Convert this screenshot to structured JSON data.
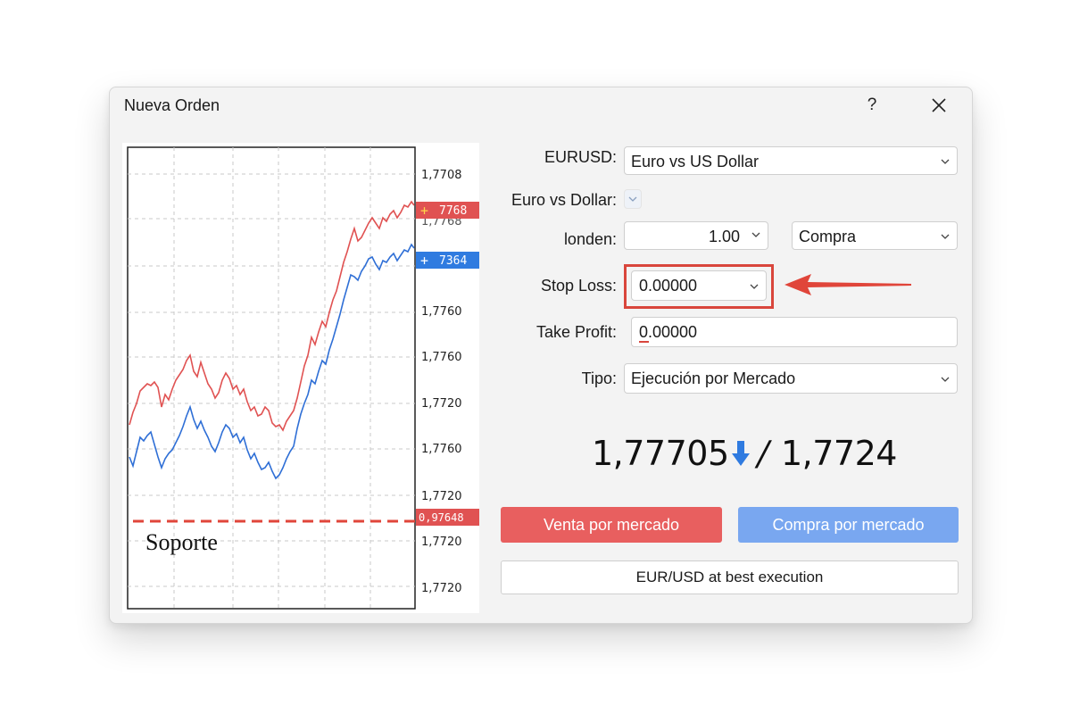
{
  "dialog": {
    "title": "Nueva Orden",
    "help_label": "?"
  },
  "chart": {
    "price_labels": [
      "1,7708",
      "1,7760",
      "1,7760",
      "1,7720",
      "1,7760",
      "1,7720",
      "1,7720"
    ],
    "faded_label": "1,7768",
    "ask_tag": "7768",
    "bid_tag": "7364",
    "support_tag": "0,97648",
    "support_label": "Soporte",
    "colors": {
      "ask": "#e05252",
      "bid": "#2f6fd6",
      "support": "#e0453a",
      "tag_ask": "#e05252",
      "tag_bid": "#2f7be0"
    }
  },
  "form": {
    "symbol_label": "EURUSD:",
    "symbol_value": "Euro vs US Dollar",
    "pair_label": "Euro vs Dollar:",
    "volume_label": "londen:",
    "volume_value": "1.00",
    "direction_value": "Compra",
    "stop_loss_label": "Stop Loss:",
    "stop_loss_value": "0.00000",
    "take_profit_label": "Take Profit:",
    "take_profit_value": "0.00000",
    "type_label": "Tipo:",
    "type_value": "Ejecución por Mercado"
  },
  "quotes": {
    "bid": "1,77705",
    "ask": "1,7724",
    "separator": "/"
  },
  "buttons": {
    "sell": "Venta por mercado",
    "buy": "Compra por mercado",
    "execution": "EUR/USD at best execution"
  },
  "accent": {
    "sell": "#e85f5f",
    "buy": "#79a7f0",
    "highlight": "#d9463c"
  }
}
